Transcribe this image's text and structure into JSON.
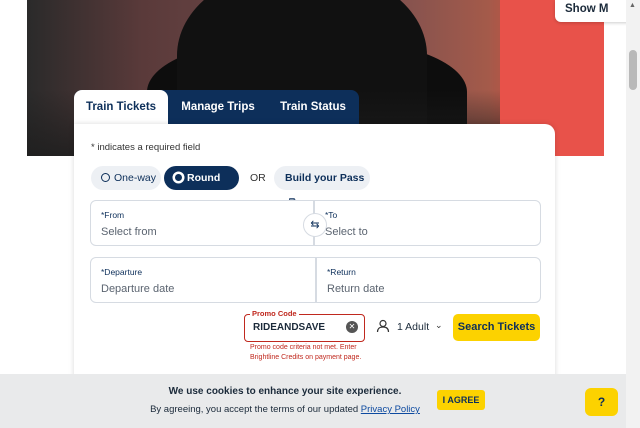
{
  "header": {
    "show_more_label": "Show M"
  },
  "tabs": [
    {
      "label": "Train Tickets",
      "active": true
    },
    {
      "label": "Manage Trips",
      "active": false
    },
    {
      "label": "Train Status",
      "active": false
    }
  ],
  "form": {
    "required_note": "* indicates a required field",
    "trip_types": {
      "oneway": "One-way",
      "round": "Round trip",
      "selected": "Round trip"
    },
    "or_label": "OR",
    "build_pass": "Build your Pass",
    "from": {
      "label": "*From",
      "placeholder": "Select from"
    },
    "to": {
      "label": "*To",
      "placeholder": "Select to"
    },
    "departure": {
      "label": "*Departure",
      "placeholder": "Departure date"
    },
    "return": {
      "label": "*Return",
      "placeholder": "Return date"
    },
    "promo": {
      "label": "Promo Code",
      "value": "RIDEANDSAVE",
      "error": "Promo code criteria not met. Enter Brightline Credits on payment page."
    },
    "passengers": "1 Adult",
    "search_label": "Search Tickets"
  },
  "cookie": {
    "line1": "We use cookies to enhance your site experience.",
    "line2_prefix": "By agreeing, you accept the terms of our updated ",
    "policy_link": "Privacy Policy",
    "agree_label": "I AGREE"
  },
  "help": {
    "label": "?"
  },
  "colors": {
    "navy": "#0d2f5a",
    "yellow": "#fcd200",
    "error": "#c0281e"
  }
}
